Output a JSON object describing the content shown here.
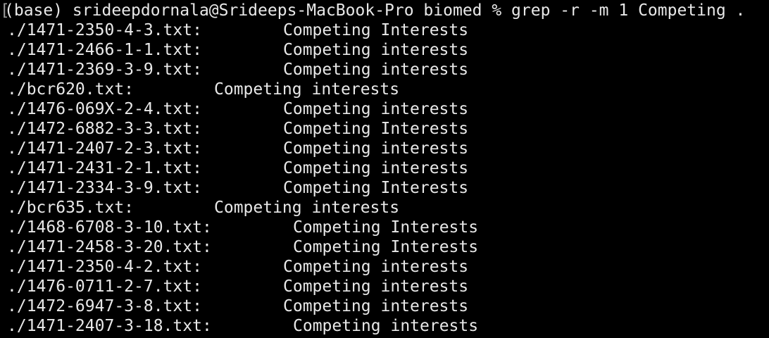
{
  "terminal": {
    "prompt_bracket": "[",
    "prompt": "(base) srideepdornala@Srideeps-MacBook-Pro biomed % grep -r -m 1 Competing .",
    "results": [
      {
        "file": "./1471-2350-4-3.txt:",
        "match": "Competing Interests",
        "col": "a"
      },
      {
        "file": "./1471-2466-1-1.txt:",
        "match": "Competing interests",
        "col": "a"
      },
      {
        "file": "./1471-2369-3-9.txt:",
        "match": "Competing interests",
        "col": "a"
      },
      {
        "file": "./bcr620.txt:",
        "match": "Competing interests",
        "col": "b"
      },
      {
        "file": "./1476-069X-2-4.txt:",
        "match": "Competing interests",
        "col": "a"
      },
      {
        "file": "./1472-6882-3-3.txt:",
        "match": "Competing Interests",
        "col": "a"
      },
      {
        "file": "./1471-2407-2-3.txt:",
        "match": "Competing interests",
        "col": "a"
      },
      {
        "file": "./1471-2431-2-1.txt:",
        "match": "Competing interests",
        "col": "a"
      },
      {
        "file": "./1471-2334-3-9.txt:",
        "match": "Competing Interests",
        "col": "a"
      },
      {
        "file": "./bcr635.txt:",
        "match": "Competing interests",
        "col": "b"
      },
      {
        "file": "./1468-6708-3-10.txt:",
        "match": "Competing Interests",
        "col": "c"
      },
      {
        "file": "./1471-2458-3-20.txt:",
        "match": "Competing Interests",
        "col": "c"
      },
      {
        "file": "./1471-2350-4-2.txt:",
        "match": "Competing interests",
        "col": "a"
      },
      {
        "file": "./1476-0711-2-7.txt:",
        "match": "Competing interests",
        "col": "a"
      },
      {
        "file": "./1472-6947-3-8.txt:",
        "match": "Competing interests",
        "col": "a"
      },
      {
        "file": "./1471-2407-3-18.txt:",
        "match": "Competing interests",
        "col": "c"
      }
    ]
  }
}
